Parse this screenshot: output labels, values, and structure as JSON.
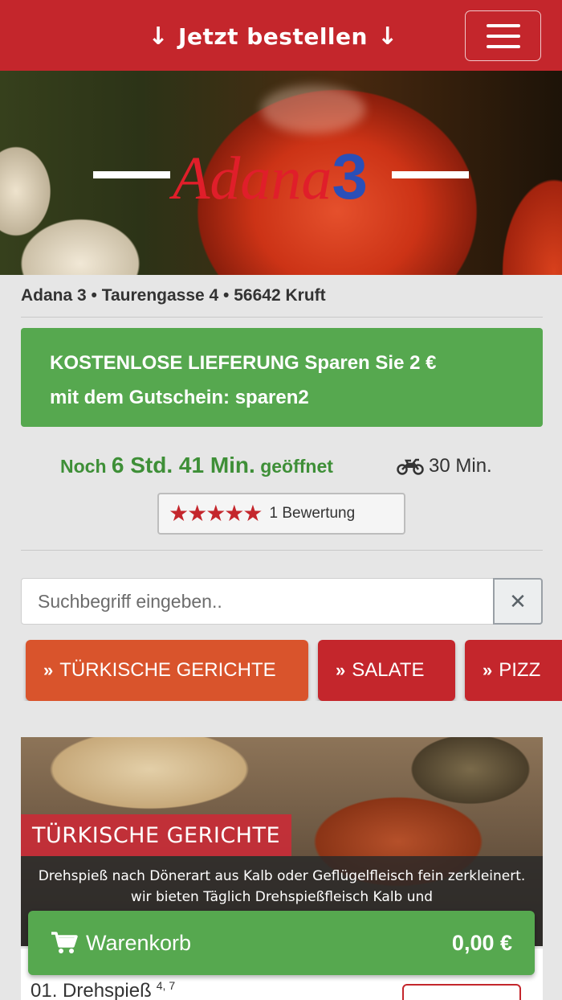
{
  "header": {
    "order_label": "Jetzt bestellen",
    "order_arrow": "↓",
    "menu_icon": "hamburger-menu-icon",
    "bar_color": "#c4262c"
  },
  "hero": {
    "logo_word": "Adana",
    "logo_number": "3"
  },
  "restaurant": {
    "address": "Adana 3 • Taurengasse 4 • 56642 Kruft"
  },
  "promo": {
    "line1": "KOSTENLOSE LIEFERUNG Sparen Sie 2 €",
    "line2": "mit dem Gutschein: sparen2",
    "color": "#56a84f"
  },
  "status": {
    "open_prefix": "Noch",
    "open_time": "6 Std. 41 Min.",
    "open_suffix": "geöffnet",
    "delivery_icon": "motorcycle-icon",
    "delivery_time": "30 Min."
  },
  "rating": {
    "stars": 5,
    "stars_display": "★★★★★",
    "label": "1 Bewertung"
  },
  "search": {
    "placeholder": "Suchbegriff eingeben..",
    "value": "",
    "clear_icon": "✕"
  },
  "categories": [
    {
      "label": "TÜRKISCHE GERICHTE",
      "icon": "»",
      "active": true
    },
    {
      "label": "SALATE",
      "icon": "»",
      "active": false
    },
    {
      "label": "PIZZ",
      "icon": "»",
      "active": false
    }
  ],
  "section": {
    "title": "TÜRKISCHE GERICHTE",
    "description": "Drehspieß nach Dönerart aus Kalb oder Geflügelfleisch fein zerkleinert. wir bieten Täglich Drehspießfleisch Kalb und"
  },
  "items": [
    {
      "name": "01. Drehspieß",
      "allergens": "4, 7"
    }
  ],
  "cart": {
    "label": "Warenkorb",
    "icon": "shopping-cart-icon",
    "total": "0,00 €"
  }
}
